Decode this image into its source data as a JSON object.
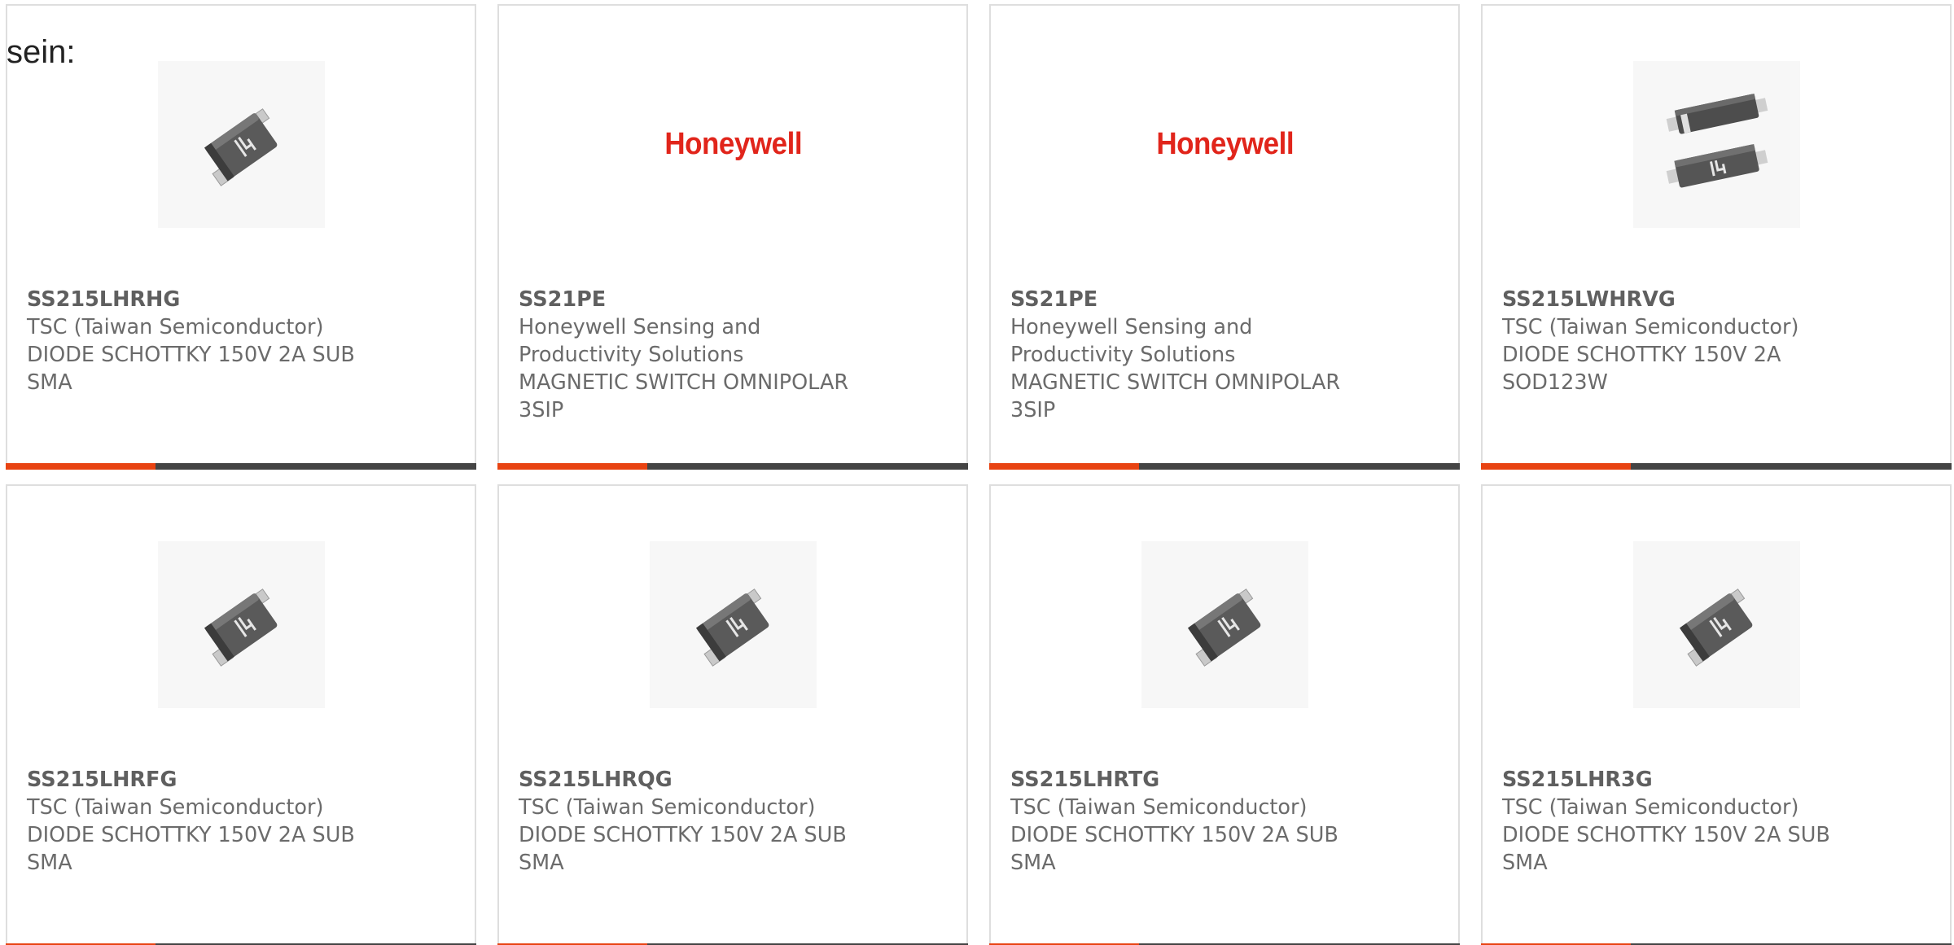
{
  "intro_text": "sein:",
  "colors": {
    "accent": "#e84312",
    "bar": "#444444",
    "brand_red": "#e1251b"
  },
  "cards": [
    {
      "part_number": "SS215LHRHG",
      "manufacturer": "TSC (Taiwan Semiconductor)",
      "description": "DIODE SCHOTTKY 150V 2A SUB SMA",
      "image": "sma-diode-package",
      "logo_text": ""
    },
    {
      "part_number": "SS21PE",
      "manufacturer": "Honeywell Sensing and Productivity Solutions",
      "description": "MAGNETIC SWITCH OMNIPOLAR 3SIP",
      "image": "honeywell-logo",
      "logo_text": "Honeywell"
    },
    {
      "part_number": "SS21PE",
      "manufacturer": "Honeywell Sensing and Productivity Solutions",
      "description": "MAGNETIC SWITCH OMNIPOLAR 3SIP",
      "image": "honeywell-logo",
      "logo_text": "Honeywell"
    },
    {
      "part_number": "SS215LWHRVG",
      "manufacturer": "TSC (Taiwan Semiconductor)",
      "description": "DIODE SCHOTTKY 150V 2A SOD123W",
      "image": "sod123w-diode-package",
      "logo_text": ""
    },
    {
      "part_number": "SS215LHRFG",
      "manufacturer": "TSC (Taiwan Semiconductor)",
      "description": "DIODE SCHOTTKY 150V 2A SUB SMA",
      "image": "sma-diode-package",
      "logo_text": ""
    },
    {
      "part_number": "SS215LHRQG",
      "manufacturer": "TSC (Taiwan Semiconductor)",
      "description": "DIODE SCHOTTKY 150V 2A SUB SMA",
      "image": "sma-diode-package",
      "logo_text": ""
    },
    {
      "part_number": "SS215LHRTG",
      "manufacturer": "TSC (Taiwan Semiconductor)",
      "description": "DIODE SCHOTTKY 150V 2A SUB SMA",
      "image": "sma-diode-package",
      "logo_text": ""
    },
    {
      "part_number": "SS215LHR3G",
      "manufacturer": "TSC (Taiwan Semiconductor)",
      "description": "DIODE SCHOTTKY 150V 2A SUB SMA",
      "image": "sma-diode-package",
      "logo_text": ""
    }
  ]
}
